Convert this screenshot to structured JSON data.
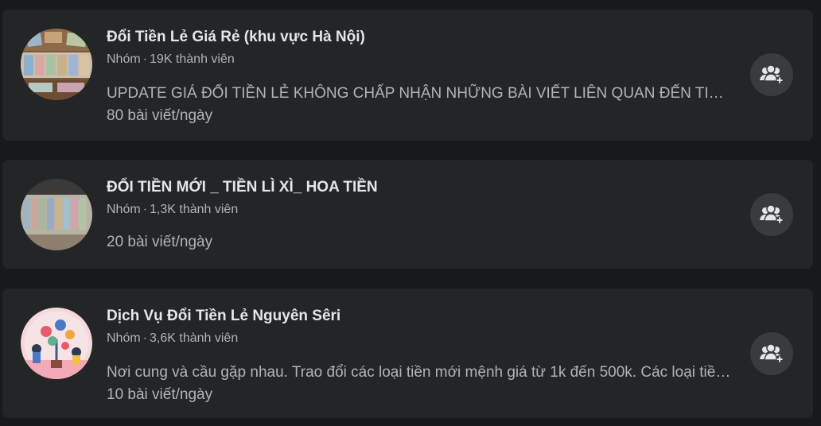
{
  "groups": [
    {
      "name": "Đổi Tiền Lẻ Giá Rẻ (khu vực Hà Nội)",
      "type": "Nhóm",
      "separator": "·",
      "members": "19K thành viên",
      "description": "UPDATE GIÁ ĐỔI TIỀN LẺ KHÔNG CHẤP NHẬN NHỮNG BÀI VIẾT LIÊN QUAN ĐẾN TIỀN ẢO, CÁC LOẠI TIỀN NƯỚC NGOÀI",
      "posts": "80 bài viết/ngày",
      "avatar_icon": "banknotes-photo",
      "join_icon": "join-group-icon"
    },
    {
      "name": "ĐỔI TIỀN MỚI _ TIỀN LÌ XÌ_ HOA TIỀN",
      "type": "Nhóm",
      "separator": "·",
      "members": "1,3K thành viên",
      "description": "",
      "posts": "20 bài viết/ngày",
      "avatar_icon": "banknotes-photo",
      "join_icon": "join-group-icon"
    },
    {
      "name": "Dịch Vụ Đổi Tiền Lẻ Nguyên Sêri",
      "type": "Nhóm",
      "separator": "·",
      "members": "3,6K thành viên",
      "description": "Nơi cung và cầu gặp nhau. Trao đổi các loại tiền mới mệnh giá từ 1k đến 500k. Các loại tiền lì xì",
      "posts": "10 bài viết/ngày",
      "avatar_icon": "illustration-photo",
      "join_icon": "join-group-icon"
    }
  ],
  "colors": {
    "page_bg": "#18191a",
    "card_bg": "#242526",
    "primary_text": "#e4e6eb",
    "secondary_text": "#b0b3b8",
    "button_bg": "#3a3b3c"
  }
}
